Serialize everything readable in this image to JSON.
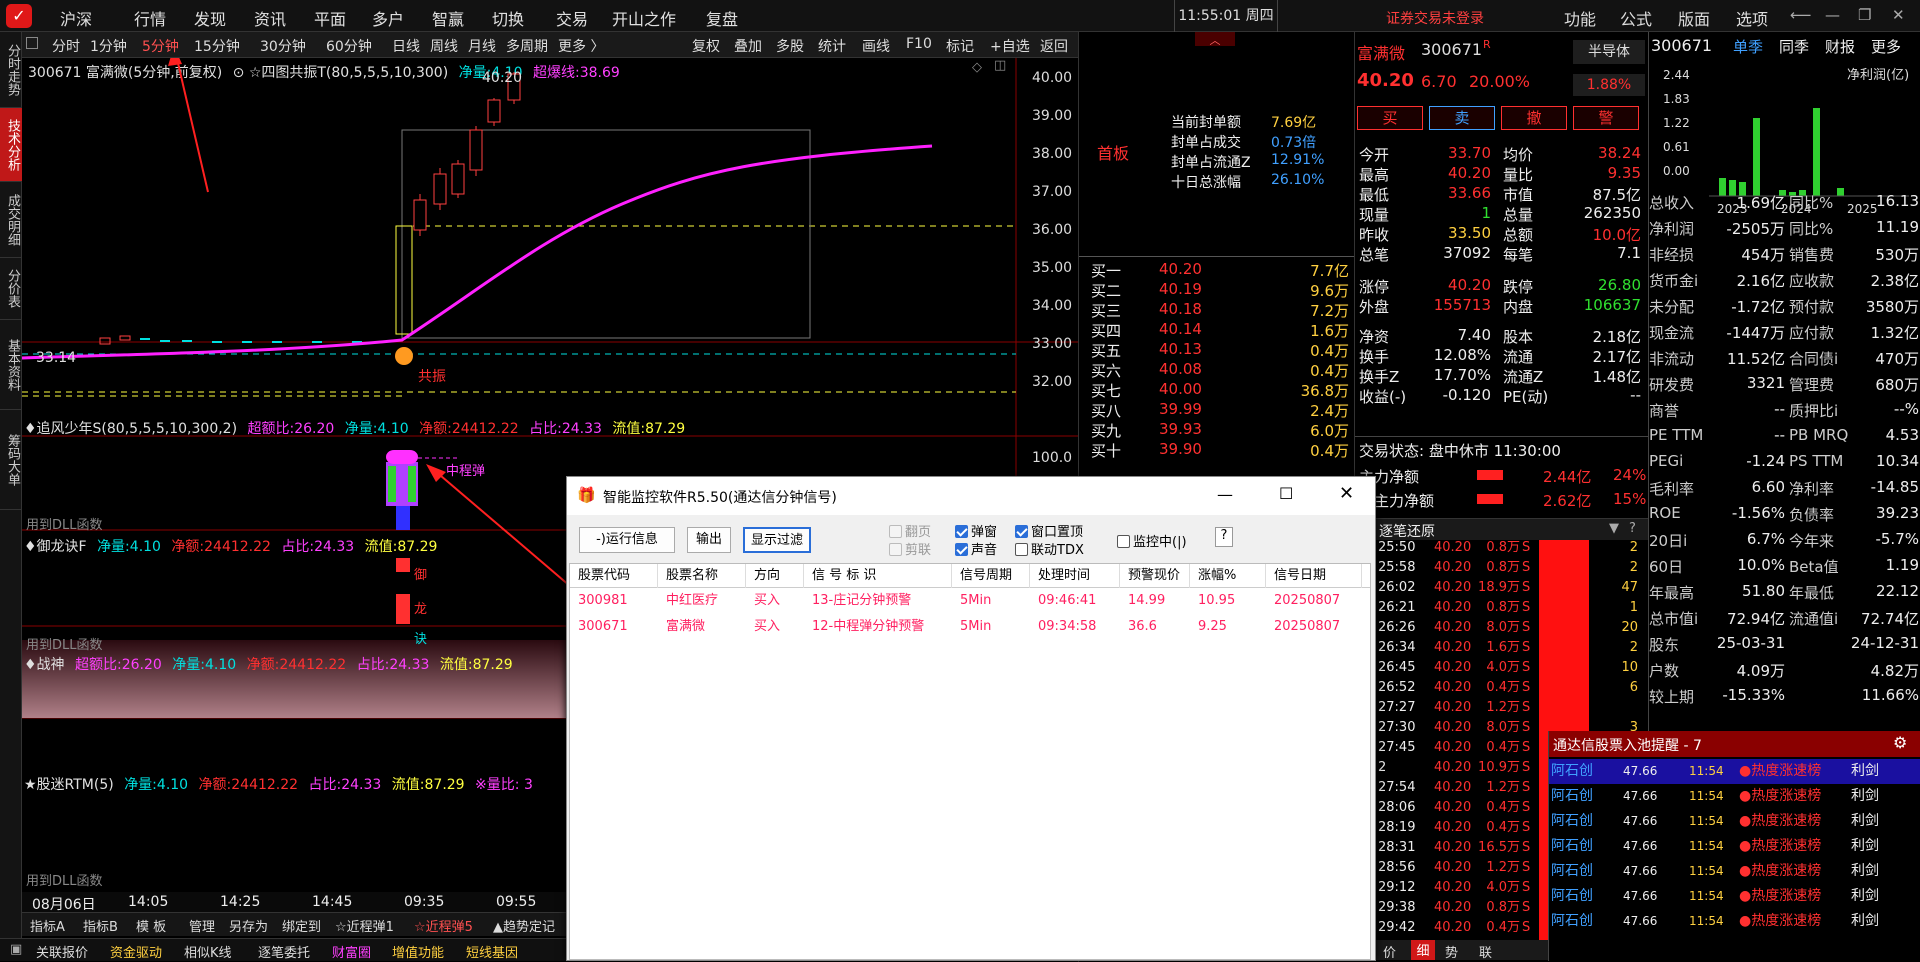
{
  "topbar": {
    "menu": [
      "沪深",
      "行情",
      "发现",
      "资讯",
      "平面",
      "多户",
      "智赢",
      "切换",
      "交易",
      "开山之作",
      "复盘"
    ],
    "clock": "11:55:01 周四",
    "login_status": "证券交易未登录",
    "right_menu": [
      "功能",
      "公式",
      "版面",
      "选项"
    ]
  },
  "sidebar": {
    "tabs": [
      "分时走势",
      "技术分析",
      "成交明细",
      "分价表",
      "基本资料",
      "筹码大单"
    ],
    "active": 1
  },
  "periods": {
    "items": [
      "分时",
      "1分钟",
      "5分钟",
      "15分钟",
      "30分钟",
      "60分钟",
      "日线",
      "周线",
      "月线",
      "多周期",
      "更多 〉"
    ],
    "selected": 2,
    "tools": [
      "复权",
      "叠加",
      "多股",
      "统计",
      "画线",
      "F10",
      "标记",
      "+自选",
      "返回"
    ]
  },
  "main_chart": {
    "stock_line": "300671 富满微(5分钟,前复权)",
    "indicator": "☆四图共振T(80,5,5,5,10,300)",
    "jl_label": "净量:",
    "jl_value": "4.10",
    "cbx_label": "超爆线:",
    "cbx_value": "38.69",
    "price_high": "40.20",
    "price_low": "33.14",
    "resonance_label": "共振",
    "yaxis": [
      "40.00",
      "39.00",
      "38.00",
      "37.00",
      "36.00",
      "35.00",
      "34.00",
      "33.00",
      "32.00"
    ]
  },
  "panel2": {
    "title": "♦追风少年S(80,5,5,5,10,300,2)",
    "cjb_label": "超额比:",
    "cjb_value": "26.20",
    "jl_label": "净量:",
    "jl_value": "4.10",
    "je_label": "净额:",
    "je_value": "24412.22",
    "zb_label": "占比:",
    "zb_value": "24.33",
    "ltl_label": "流值:",
    "ltl_value": "87.29",
    "signal_label": "中程弹",
    "yaxis": "100.0",
    "dll_text": "用到DLL函数"
  },
  "panel3": {
    "title": "♦御龙诀F",
    "jl_label": "净量:",
    "jl_value": "4.10",
    "je_label": "净额:",
    "je_value": "24412.22",
    "zb_label": "占比:",
    "zb_value": "24.33",
    "ltl_label": "流值:",
    "ltl_value": "87.29",
    "labels": [
      "御",
      "龙",
      "诀"
    ],
    "dll_text": "用到DLL函数"
  },
  "panel4": {
    "title": "♦战神",
    "cjb_label": "超额比:",
    "cjb_value": "26.20",
    "jl_label": "净量:",
    "jl_value": "4.10",
    "je_label": "净额:",
    "je_value": "24412.22",
    "zb_label": "占比:",
    "zb_value": "24.33",
    "ltl_label": "流值:",
    "ltl_value": "87.29"
  },
  "panel5": {
    "title": "★股迷RTM(5)",
    "jl_label": "净量:",
    "jl_value": "4.10",
    "je_label": "净额:",
    "je_value": "24412.22",
    "zb_label": "占比:",
    "zb_value": "24.33",
    "ltl_label": "流值:",
    "ltl_value": "87.29",
    "extra": "※量比: 3",
    "dll_text": "用到DLL函数"
  },
  "xaxis": {
    "date": "08月06日",
    "times": [
      "14:05",
      "14:25",
      "14:45",
      "09:35",
      "09:55"
    ]
  },
  "bottom_tabs": [
    "指标A",
    "指标B",
    "模 板",
    "管理",
    "另存为",
    "绑定到",
    "☆近程弹1",
    "☆近程弹5",
    "▲趋势定记"
  ],
  "status_bar": [
    "关联报价",
    "资金驱动",
    "相似K线",
    "逐笔委托",
    "财富圈",
    "增值功能",
    "短线基因"
  ],
  "board": {
    "label": "首板",
    "rows": [
      {
        "k": "当前封单额",
        "v": "7.69亿"
      },
      {
        "k": "封单占成交",
        "v": "0.73倍"
      },
      {
        "k": "封单占流通Z",
        "v": "12.91%"
      },
      {
        "k": "十日总涨幅",
        "v": "26.10%"
      }
    ]
  },
  "order_book": [
    {
      "level": "买一",
      "price": "40.20",
      "vol": "7.7亿"
    },
    {
      "level": "买二",
      "price": "40.19",
      "vol": "9.6万"
    },
    {
      "level": "买三",
      "price": "40.18",
      "vol": "7.2万"
    },
    {
      "level": "买四",
      "price": "40.14",
      "vol": "1.6万"
    },
    {
      "level": "买五",
      "price": "40.13",
      "vol": "0.4万"
    },
    {
      "level": "买六",
      "price": "40.08",
      "vol": "0.4万"
    },
    {
      "level": "买七",
      "price": "40.00",
      "vol": "36.8万"
    },
    {
      "level": "买八",
      "price": "39.99",
      "vol": "2.4万"
    },
    {
      "level": "买九",
      "price": "39.93",
      "vol": "6.0万"
    },
    {
      "level": "买十",
      "price": "39.90",
      "vol": "0.4万"
    }
  ],
  "quote": {
    "name": "富满微",
    "code": "300671",
    "tag": "R",
    "type": "半导体",
    "price": "40.20",
    "change": "6.70",
    "pct": "20.00%",
    "pct2": "1.88%",
    "buttons": [
      "买",
      "卖",
      "撤",
      "警"
    ],
    "rows": [
      [
        "今开",
        "33.70",
        "均价",
        "38.24"
      ],
      [
        "最高",
        "40.20",
        "量比",
        "9.35"
      ],
      [
        "最低",
        "33.66",
        "市值",
        "87.5亿"
      ],
      [
        "现量",
        "1",
        "总量",
        "262350"
      ],
      [
        "昨收",
        "33.50",
        "总额",
        "10.0亿"
      ],
      [
        "总笔",
        "37092",
        "每笔",
        "7.1"
      ],
      [
        "涨停",
        "40.20",
        "跌停",
        "26.80"
      ],
      [
        "外盘",
        "155713",
        "内盘",
        "106637"
      ],
      [
        "净资",
        "7.40",
        "股本",
        "2.18亿"
      ],
      [
        "换手",
        "12.08%",
        "流通",
        "2.17亿"
      ],
      [
        "换手Z",
        "17.70%",
        "流通Z",
        "1.48亿"
      ],
      [
        "收益(-)",
        "-0.120",
        "PE(动)",
        "--"
      ]
    ],
    "status": "交易状态: 盘中休市 11:30:00",
    "zl_label": "主力净额",
    "zl_value": "2.44亿",
    "zl_pct": "24%",
    "ddzl_label": "日主力净额",
    "ddzl_value": "2.62亿",
    "ddzl_pct": "15%",
    "ticks_title": "逐笔还原"
  },
  "ticks": [
    [
      "25:50",
      "40.20",
      "0.8万"
    ],
    [
      "25:58",
      "40.20",
      "0.8万"
    ],
    [
      "26:02",
      "40.20",
      "18.9万"
    ],
    [
      "26:21",
      "40.20",
      "0.8万"
    ],
    [
      "26:26",
      "40.20",
      "8.0万"
    ],
    [
      "26:34",
      "40.20",
      "1.6万"
    ],
    [
      "26:45",
      "40.20",
      "4.0万"
    ],
    [
      "26:52",
      "40.20",
      "0.4万"
    ],
    [
      "27:27",
      "40.20",
      "1.2万"
    ],
    [
      "27:30",
      "40.20",
      "8.0万"
    ],
    [
      "27:45",
      "40.20",
      "0.4万"
    ],
    [
      "2",
      "40.20",
      "10.9万"
    ],
    [
      "27:54",
      "40.20",
      "1.2万"
    ],
    [
      "28:06",
      "40.20",
      "0.4万"
    ],
    [
      "28:19",
      "40.20",
      "0.4万"
    ],
    [
      "28:31",
      "40.20",
      "16.5万"
    ],
    [
      "28:56",
      "40.20",
      "1.2万"
    ],
    [
      "29:12",
      "40.20",
      "4.0万"
    ],
    [
      "29:38",
      "40.20",
      "0.8万"
    ],
    [
      "29:42",
      "40.20",
      "0.4万"
    ]
  ],
  "tick_side": [
    "2",
    "2",
    "47",
    "1",
    "20",
    "2",
    "10",
    "6",
    "",
    "3",
    "",
    "",
    "",
    "",
    "",
    "",
    "",
    "",
    "",
    ""
  ],
  "fin": {
    "code": "300671",
    "tabs": [
      "单季",
      "同季",
      "财报",
      "更多"
    ],
    "chart_title": "净利润(亿)",
    "chart_y": [
      "2.44",
      "1.83",
      "1.22",
      "0.61",
      "0.00"
    ],
    "chart_x": [
      "2023",
      "2024",
      "2025"
    ],
    "rows": [
      [
        "总收入",
        "1.69亿",
        "同比%",
        "16.13"
      ],
      [
        "净利润",
        "-2505万",
        "同比%",
        "11.19"
      ],
      [
        "非经损",
        "454万",
        "销售费",
        "530万"
      ],
      [
        "货币金i",
        "2.16亿",
        "应收款",
        "2.38亿"
      ],
      [
        "未分配",
        "-1.72亿",
        "预付款",
        "3580万"
      ],
      [
        "现金流",
        "-1447万",
        "应付款",
        "1.32亿"
      ],
      [
        "非流动",
        "11.52亿",
        "合同债i",
        "470万"
      ],
      [
        "研发费",
        "3321",
        "管理费",
        "680万"
      ],
      [
        "商誉",
        "--",
        "质押比i",
        "--%"
      ],
      [
        "PE TTM",
        "--",
        "PB MRQ",
        "4.53"
      ],
      [
        "PEGi",
        "-1.24",
        "PS TTM",
        "10.34"
      ],
      [
        "毛利率",
        "6.60",
        "净利率",
        "-14.85"
      ],
      [
        "ROE",
        "-1.56%",
        "负债率",
        "39.23"
      ],
      [
        "20日i",
        "6.7%",
        "今年来",
        "-5.7%"
      ],
      [
        "60日",
        "10.0%",
        "Beta值",
        "1.19"
      ],
      [
        "年最高",
        "51.80",
        "年最低",
        "22.12"
      ],
      [
        "总市值i",
        "72.94亿",
        "流通值i",
        "72.74亿"
      ],
      [
        "股东",
        "25-03-31",
        "",
        "24-12-31"
      ],
      [
        "户数",
        "4.09万",
        "",
        "4.82万"
      ],
      [
        "较上期",
        "-15.33%",
        "",
        "11.66%"
      ]
    ]
  },
  "pool": {
    "title": "通达信股票入池提醒 - 7",
    "rows": [
      {
        "name": "阿石创",
        "price": "47.66",
        "time": "11:54",
        "tag": "●热度涨速榜",
        "action": "利剑"
      },
      {
        "name": "阿石创",
        "price": "47.66",
        "time": "11:54",
        "tag": "●热度涨速榜",
        "action": "利剑"
      },
      {
        "name": "阿石创",
        "price": "47.66",
        "time": "11:54",
        "tag": "●热度涨速榜",
        "action": "利剑"
      },
      {
        "name": "阿石创",
        "price": "47.66",
        "time": "11:54",
        "tag": "●热度涨速榜",
        "action": "利剑"
      },
      {
        "name": "阿石创",
        "price": "47.66",
        "time": "11:54",
        "tag": "●热度涨速榜",
        "action": "利剑"
      },
      {
        "name": "阿石创",
        "price": "47.66",
        "time": "11:54",
        "tag": "●热度涨速榜",
        "action": "利剑"
      },
      {
        "name": "阿石创",
        "price": "47.66",
        "time": "11:54",
        "tag": "●热度涨速榜",
        "action": "利剑"
      }
    ]
  },
  "dialog": {
    "title": "智能监控软件R5.50(通达信分钟信号)",
    "btn_run": "-)运行信息",
    "btn_output": "输出",
    "btn_filter": "显示过滤",
    "chk_flip": "翻页",
    "chk_popup": "弹窗",
    "chk_topmost": "窗口置顶",
    "chk_cut": "剪联",
    "chk_sound": "声音",
    "chk_tdx": "联动TDX",
    "chk_monitor": "监控中(|)",
    "help": "?",
    "columns": [
      "股票代码",
      "股票名称",
      "方向",
      "信 号 标 识",
      "信号周期",
      "处理时间",
      "预警现价",
      "涨幅%",
      "信号日期"
    ],
    "rows": [
      [
        "300981",
        "中红医疗",
        "买入",
        "13-庄记分钟预警",
        "5Min",
        "09:46:41",
        "14.99",
        "10.95",
        "20250807"
      ],
      [
        "300671",
        "富满微",
        "买入",
        "12-中程弹分钟预警",
        "5Min",
        "09:34:58",
        "36.6",
        "9.25",
        "20250807"
      ]
    ]
  },
  "colors": {
    "red": "#ff3030",
    "magenta": "#ff40ff",
    "cyan": "#00e0e0",
    "yellow": "#ffff40",
    "green": "#30e030"
  }
}
